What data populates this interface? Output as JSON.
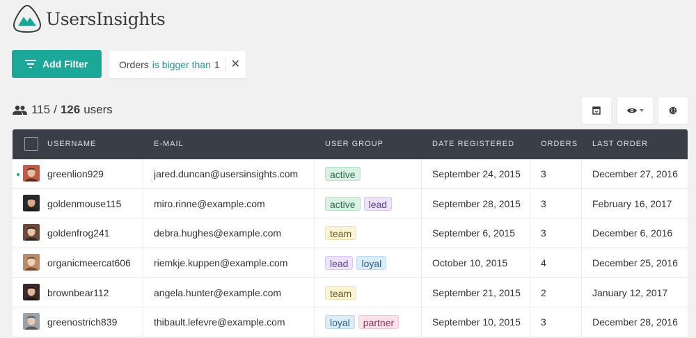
{
  "brand": {
    "name": "UsersInsights"
  },
  "toolbar": {
    "add_filter_label": "Add Filter",
    "filter": {
      "field": "Orders",
      "operator": "is bigger than",
      "value": "1"
    }
  },
  "summary": {
    "filtered": "115",
    "separator": "/",
    "total": "126",
    "unit": "users"
  },
  "table": {
    "columns": [
      "USERNAME",
      "E-MAIL",
      "USER GROUP",
      "DATE REGISTERED",
      "ORDERS",
      "LAST ORDER"
    ],
    "rows": [
      {
        "username": "greenlion929",
        "email": "jared.duncan@usersinsights.com",
        "groups": [
          "active"
        ],
        "registered": "September 24, 2015",
        "orders": "3",
        "last_order": "December 27, 2016"
      },
      {
        "username": "goldenmouse115",
        "email": "miro.rinne@example.com",
        "groups": [
          "active",
          "lead"
        ],
        "registered": "September 28, 2015",
        "orders": "3",
        "last_order": "February 16, 2017"
      },
      {
        "username": "goldenfrog241",
        "email": "debra.hughes@example.com",
        "groups": [
          "team"
        ],
        "registered": "September 6, 2015",
        "orders": "3",
        "last_order": "December 6, 2016"
      },
      {
        "username": "organicmeercat606",
        "email": "riemkje.kuppen@example.com",
        "groups": [
          "lead",
          "loyal"
        ],
        "registered": "October 10, 2015",
        "orders": "4",
        "last_order": "December 25, 2016"
      },
      {
        "username": "brownbear112",
        "email": "angela.hunter@example.com",
        "groups": [
          "team"
        ],
        "registered": "September 21, 2015",
        "orders": "2",
        "last_order": "January 12, 2017"
      },
      {
        "username": "greenostrich839",
        "email": "thibault.lefevre@example.com",
        "groups": [
          "loyal",
          "partner"
        ],
        "registered": "September 10, 2015",
        "orders": "3",
        "last_order": "December 28, 2016"
      }
    ]
  },
  "colors": {
    "accent": "#1ba899",
    "header_bg": "#3a3f47",
    "tags": {
      "active": {
        "bg": "#d9f2e3",
        "border": "#b5e3c6",
        "fg": "#2f6b47"
      },
      "lead": {
        "bg": "#ede3fb",
        "border": "#d8c6f3",
        "fg": "#5b3f8a"
      },
      "team": {
        "bg": "#fdf4d6",
        "border": "#f1e0a8",
        "fg": "#6d5a1e"
      },
      "loyal": {
        "bg": "#dcedfa",
        "border": "#bcd9f2",
        "fg": "#2c5a82"
      },
      "partner": {
        "bg": "#fde2ea",
        "border": "#f6c5d4",
        "fg": "#8a3450"
      }
    }
  },
  "icons": [
    "logo-mountain-icon",
    "filter-lines-icon",
    "close-icon",
    "users-icon",
    "columns-icon",
    "eye-icon",
    "globe-icon"
  ]
}
